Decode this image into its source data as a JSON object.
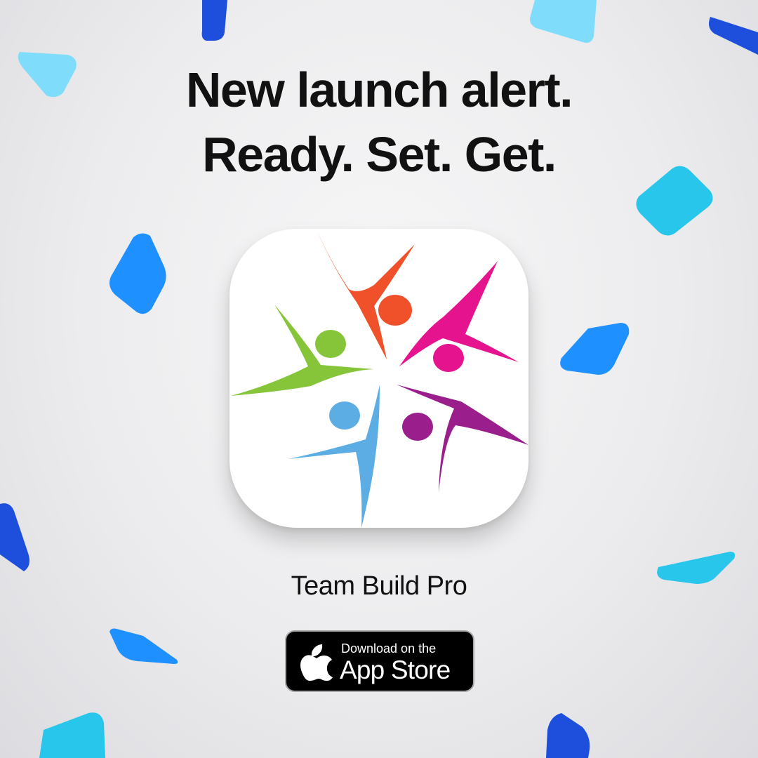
{
  "headline": {
    "line1": "New launch alert.",
    "line2": "Ready. Set. Get."
  },
  "app": {
    "name": "Team Build Pro",
    "icon": "team-build-pro-app-icon",
    "figure_colors": [
      "#f0502a",
      "#e6138f",
      "#9a1f8c",
      "#5bade3",
      "#86c53a"
    ]
  },
  "badge": {
    "line1": "Download on the",
    "line2": "App Store",
    "icon": "apple-logo-icon"
  },
  "palette": {
    "confetti": [
      "#1e90ff",
      "#27c6ea",
      "#7fdcfb",
      "#1d4fdc"
    ]
  }
}
